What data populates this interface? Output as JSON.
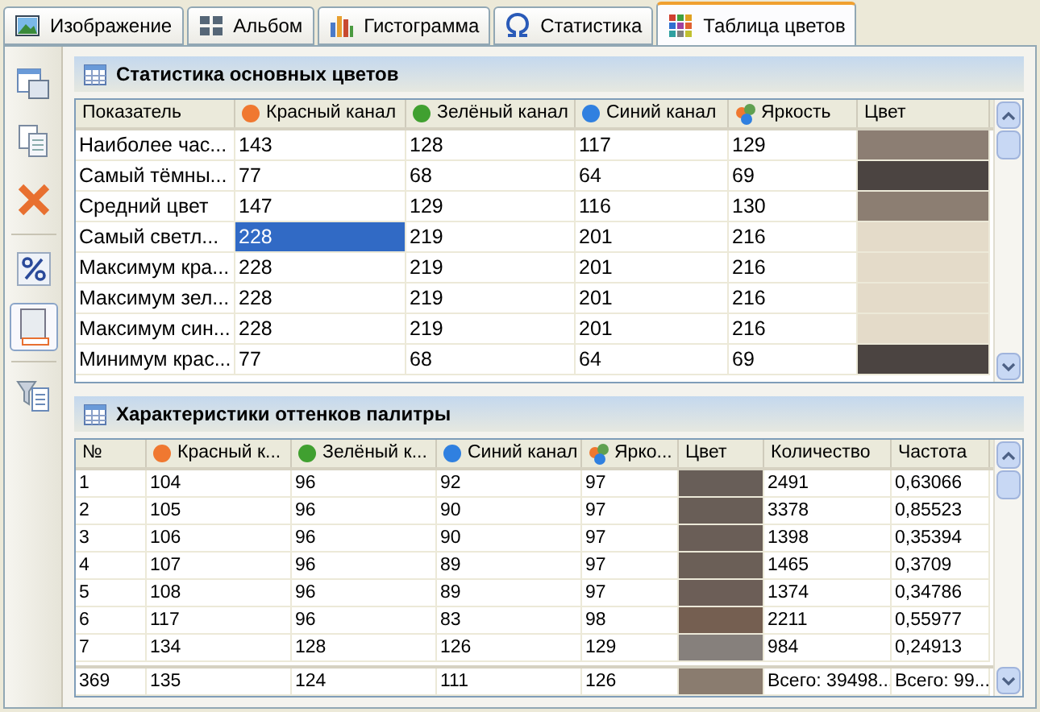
{
  "tabs": [
    {
      "label": "Изображение",
      "selected": false
    },
    {
      "label": "Альбом",
      "selected": false
    },
    {
      "label": "Гистограмма",
      "selected": false
    },
    {
      "label": "Статистика",
      "selected": false
    },
    {
      "label": "Таблица цветов",
      "selected": true
    }
  ],
  "toolbar": [
    {
      "pressed": false
    },
    {
      "pressed": false
    },
    {
      "pressed": false
    },
    {
      "pressed": false
    },
    {
      "pressed": true
    },
    {
      "pressed": false
    }
  ],
  "main_colors": {
    "title": "Статистика основных цветов",
    "columns": [
      {
        "label": "Показатель",
        "kind": "text"
      },
      {
        "label": "Красный канал",
        "kind": "dot",
        "color": "#f07830"
      },
      {
        "label": "Зелёный канал",
        "kind": "dot",
        "color": "#40a030"
      },
      {
        "label": "Синий канал",
        "kind": "dot",
        "color": "#3080e0"
      },
      {
        "label": "Яркость",
        "kind": "brightness"
      },
      {
        "label": "Цвет",
        "kind": "swatch"
      }
    ],
    "rows": [
      {
        "cells": [
          {
            "text": "Наиболее час...",
            "selected": false
          },
          {
            "text": "143",
            "selected": false
          },
          {
            "text": "128",
            "selected": false
          },
          {
            "text": "117",
            "selected": false
          },
          {
            "text": "129",
            "selected": false
          },
          {
            "color": "#8c7e73",
            "selected": false
          }
        ]
      },
      {
        "cells": [
          {
            "text": "Самый тёмны...",
            "selected": false
          },
          {
            "text": "77",
            "selected": false
          },
          {
            "text": "68",
            "selected": false
          },
          {
            "text": "64",
            "selected": false
          },
          {
            "text": "69",
            "selected": false
          },
          {
            "color": "#4b4441",
            "selected": false
          }
        ]
      },
      {
        "cells": [
          {
            "text": "Средний цвет",
            "selected": false
          },
          {
            "text": "147",
            "selected": false
          },
          {
            "text": "129",
            "selected": false
          },
          {
            "text": "116",
            "selected": false
          },
          {
            "text": "130",
            "selected": false
          },
          {
            "color": "#8c7e72",
            "selected": false
          }
        ]
      },
      {
        "cells": [
          {
            "text": "Самый светл...",
            "selected": false
          },
          {
            "text": "228",
            "selected": true
          },
          {
            "text": "219",
            "selected": false
          },
          {
            "text": "201",
            "selected": false
          },
          {
            "text": "216",
            "selected": false
          },
          {
            "color": "#e4dbc9",
            "selected": false
          }
        ]
      },
      {
        "cells": [
          {
            "text": "Максимум кра...",
            "selected": false
          },
          {
            "text": "228",
            "selected": false
          },
          {
            "text": "219",
            "selected": false
          },
          {
            "text": "201",
            "selected": false
          },
          {
            "text": "216",
            "selected": false
          },
          {
            "color": "#e4dbc9",
            "selected": false
          }
        ]
      },
      {
        "cells": [
          {
            "text": "Максимум зел...",
            "selected": false
          },
          {
            "text": "228",
            "selected": false
          },
          {
            "text": "219",
            "selected": false
          },
          {
            "text": "201",
            "selected": false
          },
          {
            "text": "216",
            "selected": false
          },
          {
            "color": "#e4dbc9",
            "selected": false
          }
        ]
      },
      {
        "cells": [
          {
            "text": "Максимум син...",
            "selected": false
          },
          {
            "text": "228",
            "selected": false
          },
          {
            "text": "219",
            "selected": false
          },
          {
            "text": "201",
            "selected": false
          },
          {
            "text": "216",
            "selected": false
          },
          {
            "color": "#e4dbc9",
            "selected": false
          }
        ]
      },
      {
        "cells": [
          {
            "text": "Минимум крас...",
            "selected": false
          },
          {
            "text": "77",
            "selected": false
          },
          {
            "text": "68",
            "selected": false
          },
          {
            "text": "64",
            "selected": false
          },
          {
            "text": "69",
            "selected": false
          },
          {
            "color": "#4b4441",
            "selected": false
          }
        ]
      }
    ]
  },
  "palette": {
    "title": "Характеристики оттенков палитры",
    "columns": [
      {
        "label": "№",
        "kind": "text"
      },
      {
        "label": "Красный к...",
        "kind": "dot",
        "color": "#f07830"
      },
      {
        "label": "Зелёный к...",
        "kind": "dot",
        "color": "#40a030"
      },
      {
        "label": "Синий канал",
        "kind": "dot",
        "color": "#3080e0"
      },
      {
        "label": "Ярко...",
        "kind": "brightness"
      },
      {
        "label": "Цвет",
        "kind": "swatch"
      },
      {
        "label": "Количество",
        "kind": "text"
      },
      {
        "label": "Частота",
        "kind": "text"
      }
    ],
    "rows": [
      {
        "cells": [
          "1",
          "104",
          "96",
          "92",
          "97",
          "",
          "2491",
          "0,63066"
        ],
        "color": "#685e58"
      },
      {
        "cells": [
          "2",
          "105",
          "96",
          "90",
          "97",
          "",
          "3378",
          "0,85523"
        ],
        "color": "#695e57"
      },
      {
        "cells": [
          "3",
          "106",
          "96",
          "90",
          "97",
          "",
          "1398",
          "0,35394"
        ],
        "color": "#6a5e57"
      },
      {
        "cells": [
          "4",
          "107",
          "96",
          "89",
          "97",
          "",
          "1465",
          "0,3709"
        ],
        "color": "#6b5f57"
      },
      {
        "cells": [
          "5",
          "108",
          "96",
          "89",
          "97",
          "",
          "1374",
          "0,34786"
        ],
        "color": "#6c5e57"
      },
      {
        "cells": [
          "6",
          "117",
          "96",
          "83",
          "98",
          "",
          "2211",
          "0,55977"
        ],
        "color": "#755f51"
      },
      {
        "cells": [
          "7",
          "134",
          "128",
          "126",
          "129",
          "",
          "984",
          "0,24913"
        ],
        "color": "#86807c"
      }
    ],
    "total": {
      "cells": [
        "369",
        "135",
        "124",
        "111",
        "126",
        "",
        "Всего: 39498...",
        "Всего: 99..."
      ],
      "color": "#8a7c6f"
    }
  }
}
